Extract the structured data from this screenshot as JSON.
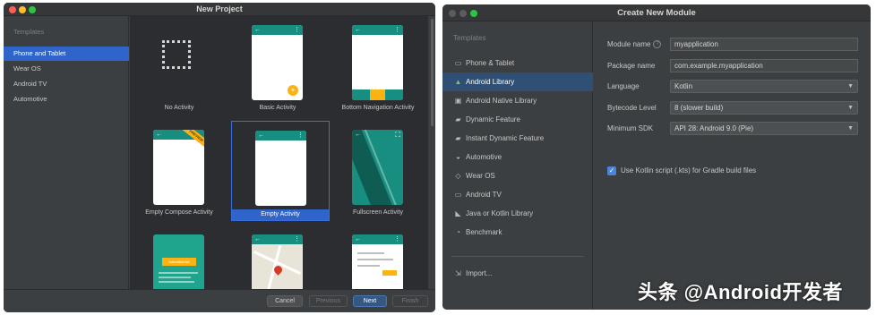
{
  "window1": {
    "title": "New Project",
    "sidebar": {
      "header": "Templates",
      "items": [
        {
          "label": "Phone and Tablet",
          "selected": true
        },
        {
          "label": "Wear OS",
          "selected": false
        },
        {
          "label": "Android TV",
          "selected": false
        },
        {
          "label": "Automotive",
          "selected": false
        }
      ]
    },
    "templates": [
      {
        "label": "No Activity"
      },
      {
        "label": "Basic Activity"
      },
      {
        "label": "Bottom Navigation Activity"
      },
      {
        "label": "Empty Compose Activity",
        "ribbon": "PREVIEW"
      },
      {
        "label": "Empty Activity",
        "selected": true
      },
      {
        "label": "Fullscreen Activity"
      },
      {
        "label": "",
        "button": "Interstitial Ad"
      },
      {
        "label": ""
      },
      {
        "label": ""
      }
    ],
    "footer": {
      "cancel": "Cancel",
      "previous": "Previous",
      "next": "Next",
      "finish": "Finish"
    }
  },
  "window2": {
    "title": "Create New Module",
    "sidebar": {
      "header": "Templates",
      "items": [
        {
          "label": "Phone & Tablet",
          "icon": "phone-tablet-icon",
          "selected": false
        },
        {
          "label": "Android Library",
          "icon": "android-icon",
          "selected": true
        },
        {
          "label": "Android Native Library",
          "icon": "native-library-icon",
          "selected": false
        },
        {
          "label": "Dynamic Feature",
          "icon": "folder-icon",
          "selected": false
        },
        {
          "label": "Instant Dynamic Feature",
          "icon": "folder-icon",
          "selected": false
        },
        {
          "label": "Automotive",
          "icon": "car-icon",
          "selected": false
        },
        {
          "label": "Wear OS",
          "icon": "watch-icon",
          "selected": false
        },
        {
          "label": "Android TV",
          "icon": "tv-icon",
          "selected": false
        },
        {
          "label": "Java or Kotlin Library",
          "icon": "kotlin-icon",
          "selected": false
        },
        {
          "label": "Benchmark",
          "icon": "benchmark-icon",
          "selected": false
        }
      ],
      "import": "Import..."
    },
    "form": {
      "module_name_label": "Module name",
      "module_name_value": "myapplication",
      "package_name_label": "Package name",
      "package_name_value": "com.example.myapplication",
      "language_label": "Language",
      "language_value": "Kotlin",
      "bytecode_label": "Bytecode Level",
      "bytecode_value": "8 (slower build)",
      "min_sdk_label": "Minimum SDK",
      "min_sdk_value": "API 28: Android 9.0 (Pie)",
      "kts_label": "Use Kotlin script (.kts) for Gradle build files",
      "kts_checked": true
    }
  },
  "watermark": "头条 @Android开发者"
}
